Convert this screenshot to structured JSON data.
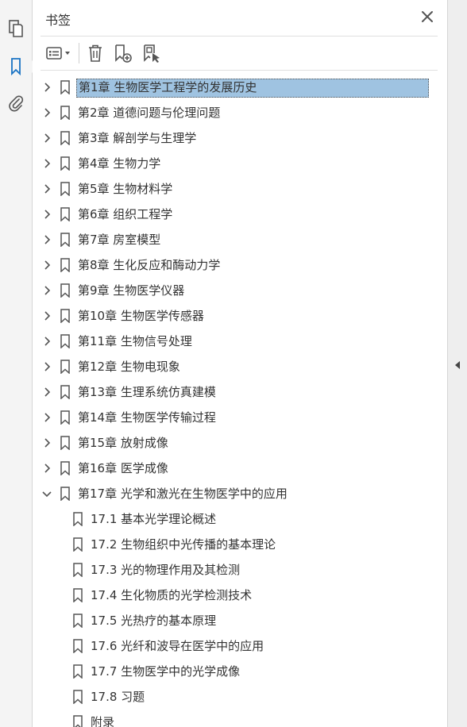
{
  "panel": {
    "title": "书签"
  },
  "icons": {
    "rail": [
      "pages-icon",
      "bookmark-icon",
      "attachment-icon"
    ],
    "toolbar": [
      "options-icon",
      "delete-icon",
      "new-bookmark-icon",
      "bookmark-from-selection-icon"
    ]
  },
  "colors": {
    "accent": "#1a73c4",
    "selected_bg": "#9fc3e1",
    "icon": "#555555"
  },
  "bookmarks": [
    {
      "label": "第1章 生物医学工程学的发展历史",
      "level": 0,
      "expanded": false,
      "selected": true
    },
    {
      "label": "第2章 道德问题与伦理问题",
      "level": 0,
      "expanded": false
    },
    {
      "label": "第3章 解剖学与生理学",
      "level": 0,
      "expanded": false
    },
    {
      "label": "第4章 生物力学",
      "level": 0,
      "expanded": false
    },
    {
      "label": "第5章 生物材料学",
      "level": 0,
      "expanded": false
    },
    {
      "label": "第6章 组织工程学",
      "level": 0,
      "expanded": false
    },
    {
      "label": "第7章 房室模型",
      "level": 0,
      "expanded": false
    },
    {
      "label": "第8章 生化反应和酶动力学",
      "level": 0,
      "expanded": false
    },
    {
      "label": "第9章 生物医学仪器",
      "level": 0,
      "expanded": false
    },
    {
      "label": "第10章 生物医学传感器",
      "level": 0,
      "expanded": false
    },
    {
      "label": "第11章 生物信号处理",
      "level": 0,
      "expanded": false
    },
    {
      "label": "第12章 生物电现象",
      "level": 0,
      "expanded": false
    },
    {
      "label": "第13章 生理系统仿真建模",
      "level": 0,
      "expanded": false
    },
    {
      "label": "第14章 生物医学传输过程",
      "level": 0,
      "expanded": false
    },
    {
      "label": "第15章 放射成像",
      "level": 0,
      "expanded": false
    },
    {
      "label": "第16章 医学成像",
      "level": 0,
      "expanded": false
    },
    {
      "label": "第17章 光学和激光在生物医学中的应用",
      "level": 0,
      "expanded": true
    },
    {
      "label": "17.1 基本光学理论概述",
      "level": 1
    },
    {
      "label": "17.2 生物组织中光传播的基本理论",
      "level": 1
    },
    {
      "label": "17.3 光的物理作用及其检测",
      "level": 1
    },
    {
      "label": "17.4 生化物质的光学检测技术",
      "level": 1
    },
    {
      "label": "17.5 光热疗的基本原理",
      "level": 1
    },
    {
      "label": "17.6 光纤和波导在医学中的应用",
      "level": 1
    },
    {
      "label": "17.7 生物医学中的光学成像",
      "level": 1
    },
    {
      "label": "17.8 习题",
      "level": 1
    },
    {
      "label": "附录",
      "level": 1
    }
  ]
}
